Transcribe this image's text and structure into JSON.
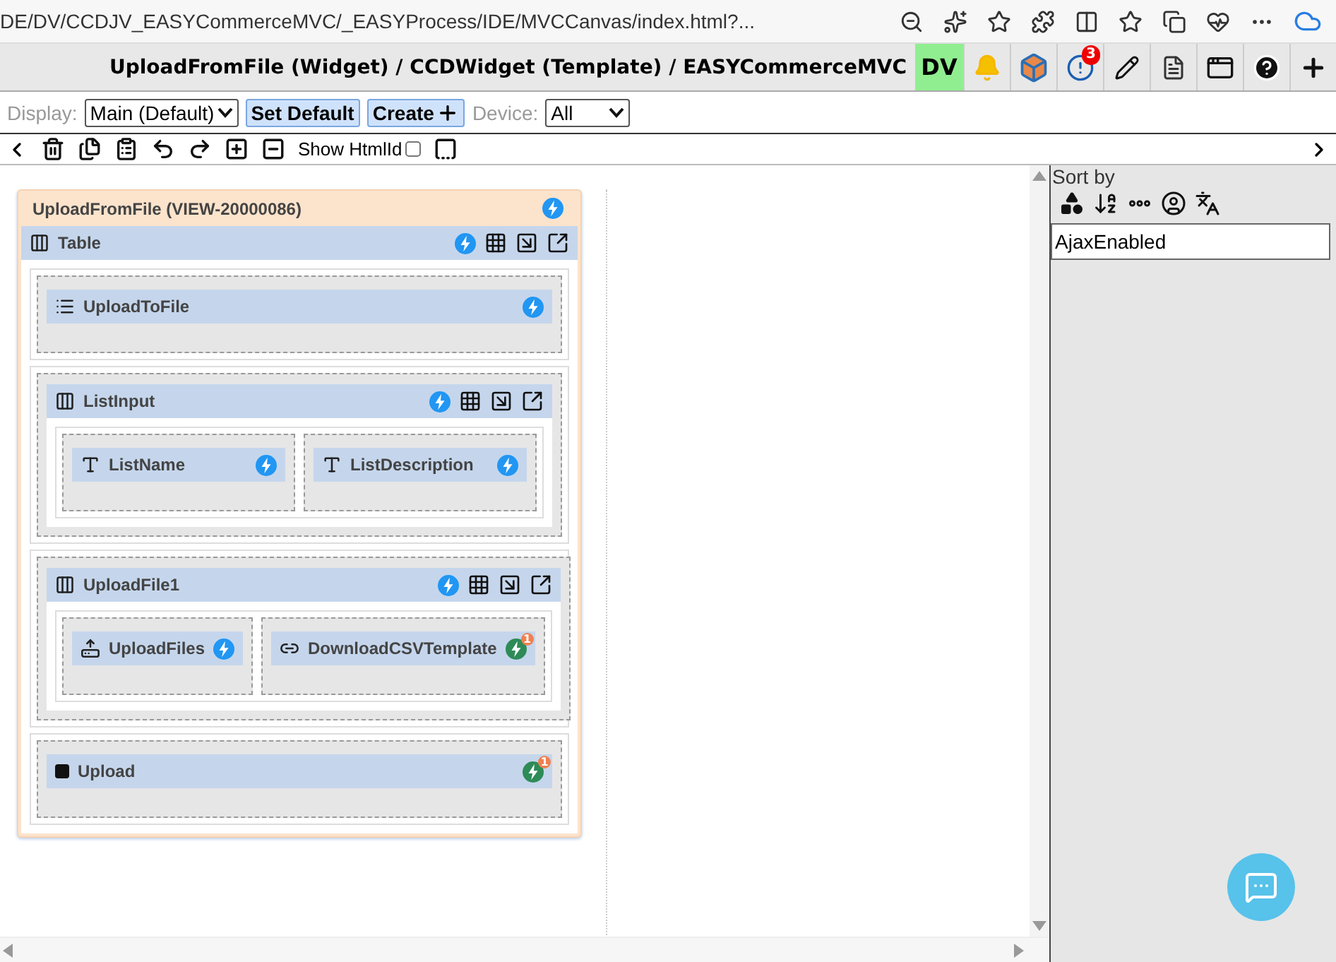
{
  "browser": {
    "url": "DE/DV/CCDJV_EASYCommerceMVC/_EASYProcess/IDE/MVCCanvas/index.html?..."
  },
  "header": {
    "breadcrumb": "UploadFromFile (Widget) / CCDWidget (Template) / EASYCommerceMVC",
    "dv": "DV",
    "alert_count": "3"
  },
  "toolbar": {
    "display_label": "Display:",
    "display_value": "Main (Default)",
    "set_default": "Set Default",
    "create": "Create",
    "device_label": "Device:",
    "device_value": "All"
  },
  "edit_bar": {
    "show_htmlid_label": "Show HtmlId",
    "show_htmlid_checked": false
  },
  "sort_panel": {
    "title": "Sort by",
    "search_value": "AjaxEnabled"
  },
  "view": {
    "title": "UploadFromFile (VIEW-20000086)",
    "root": {
      "kind": "table",
      "name": "Table",
      "color": "#2196f3",
      "rows": [
        [
          {
            "kind": "list",
            "name": "UploadToFile",
            "color": "#2196f3"
          }
        ],
        [
          {
            "kind": "table",
            "name": "ListInput",
            "color": "#2196f3",
            "rows": [
              [
                {
                  "kind": "textbox",
                  "name": "ListName",
                  "color": "#2196f3"
                },
                {
                  "kind": "textbox",
                  "name": "ListDescription",
                  "color": "#2196f3"
                }
              ]
            ]
          }
        ],
        [
          {
            "kind": "table",
            "name": "UploadFile1",
            "color": "#2196f3",
            "rows": [
              [
                {
                  "kind": "upload",
                  "name": "UploadFiles",
                  "color": "#2196f3"
                },
                {
                  "kind": "link",
                  "name": "DownloadCSVTemplate",
                  "color": "#2e8b57",
                  "event_count": "1"
                }
              ]
            ]
          }
        ],
        [
          {
            "kind": "button",
            "name": "Upload",
            "color": "#2e8b57",
            "event_count": "1"
          }
        ]
      ]
    }
  }
}
